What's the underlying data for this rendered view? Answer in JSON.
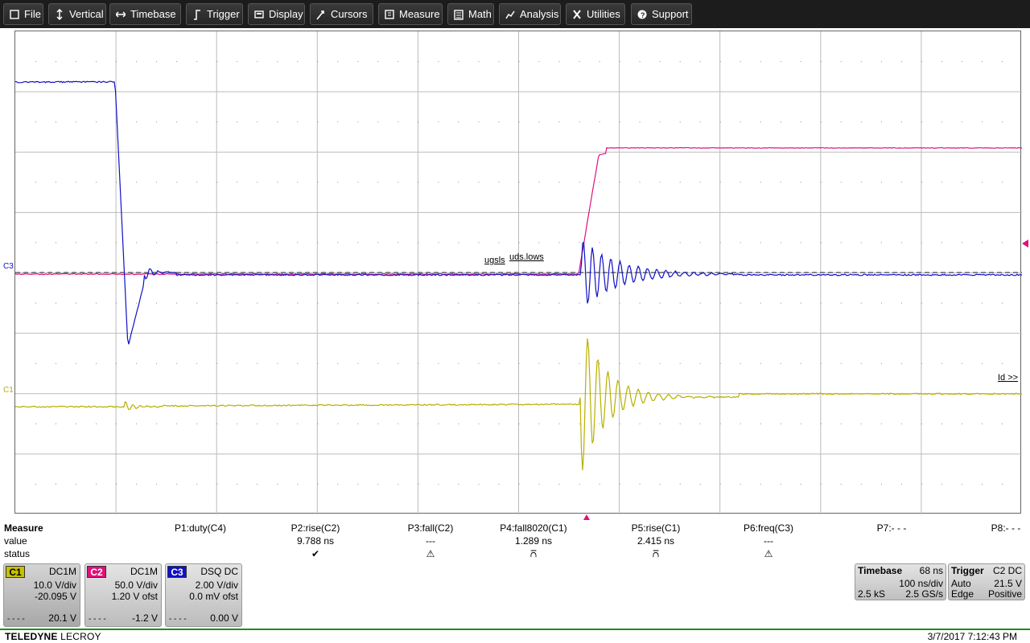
{
  "menu": [
    {
      "label": "File",
      "icon": "file-icon"
    },
    {
      "label": "Vertical",
      "icon": "vertical-arrows-icon"
    },
    {
      "label": "Timebase",
      "icon": "horizontal-arrows-icon"
    },
    {
      "label": "Trigger",
      "icon": "trigger-icon"
    },
    {
      "label": "Display",
      "icon": "display-icon"
    },
    {
      "label": "Cursors",
      "icon": "cursor-icon"
    },
    {
      "label": "Measure",
      "icon": "measure-icon"
    },
    {
      "label": "Math",
      "icon": "calculator-icon"
    },
    {
      "label": "Analysis",
      "icon": "chart-icon"
    },
    {
      "label": "Utilities",
      "icon": "wrench-icon"
    },
    {
      "label": "Support",
      "icon": "help-icon"
    }
  ],
  "markers": {
    "c3_left": "C3",
    "c1_left": "C1",
    "ugsls": "ugsls",
    "udslows": "uds.lows",
    "id_label": "Id >>"
  },
  "colors": {
    "c1": "#b8b000",
    "c2": "#e0107a",
    "c3": "#1010c8",
    "grid": "#bbbbbb"
  },
  "measure": {
    "title": "Measure",
    "row_value": "value",
    "row_status": "status",
    "params": [
      {
        "name": "P1:duty(C4)",
        "value": "",
        "status": ""
      },
      {
        "name": "P2:rise(C2)",
        "value": "9.788 ns",
        "status": "✔"
      },
      {
        "name": "P3:fall(C2)",
        "value": "---",
        "status": "⚠"
      },
      {
        "name": "P4:fall8020(C1)",
        "value": "1.289 ns",
        "status": "⩃"
      },
      {
        "name": "P5:rise(C1)",
        "value": "2.415 ns",
        "status": "⩃"
      },
      {
        "name": "P6:freq(C3)",
        "value": "---",
        "status": "⚠"
      },
      {
        "name": "P7:- - -",
        "value": "",
        "status": ""
      },
      {
        "name": "P8:- - -",
        "value": "",
        "status": ""
      }
    ]
  },
  "channels": [
    {
      "tag": "C1",
      "coupling": "DC1M",
      "vdiv": "10.0 V/div",
      "offset": "-20.095 V",
      "bottom": "20.1 V",
      "dash": "- - - -"
    },
    {
      "tag": "C2",
      "coupling": "DC1M",
      "vdiv": "50.0 V/div",
      "offset": "1.20 V ofst",
      "bottom": "-1.2 V",
      "dash": "- - - -"
    },
    {
      "tag": "C3",
      "coupling": "DSQ  DC",
      "vdiv": "2.00 V/div",
      "offset": "0.0 mV ofst",
      "bottom": "0.00 V",
      "dash": "- - - -"
    }
  ],
  "timebase": {
    "title": "Timebase",
    "delay": "68 ns",
    "tdiv": "100 ns/div",
    "samples": "2.5 kS",
    "rate": "2.5 GS/s"
  },
  "trigger": {
    "title": "Trigger",
    "source": "C2  DC",
    "mode": "Auto",
    "level": "21.5 V",
    "type": "Edge",
    "slope": "Positive"
  },
  "footer": {
    "brand_bold": "TELEDYNE",
    "brand_rest": " LECROY",
    "datetime": "3/7/2017 7:12:43 PM"
  }
}
